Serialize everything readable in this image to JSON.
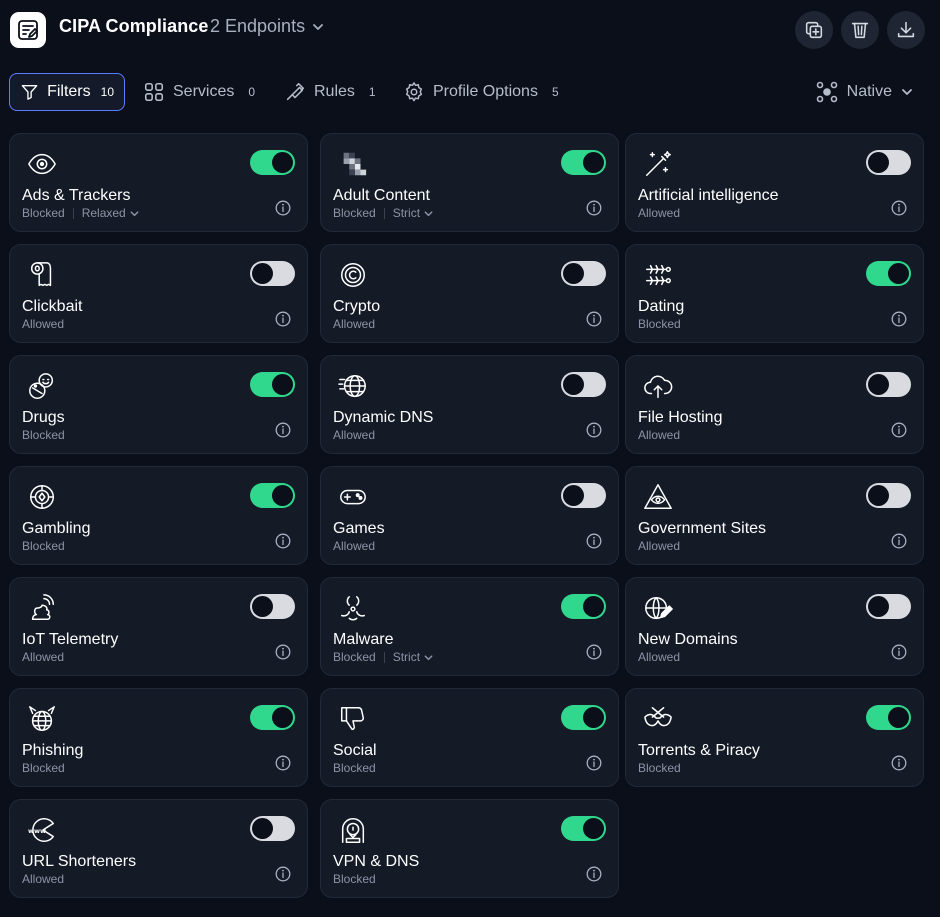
{
  "header": {
    "profile_name": "CIPA Compliance",
    "endpoints_label": "2 Endpoints"
  },
  "toolbar": {
    "tabs": [
      {
        "label": "Filters",
        "count": "10",
        "active": true,
        "icon": "filter-icon"
      },
      {
        "label": "Services",
        "count": "0",
        "active": false,
        "icon": "grid-icon"
      },
      {
        "label": "Rules",
        "count": "1",
        "active": false,
        "icon": "route-icon"
      },
      {
        "label": "Profile Options",
        "count": "5",
        "active": false,
        "icon": "gear-icon"
      }
    ],
    "mode_label": "Native"
  },
  "colors": {
    "background": "#0b0f1a",
    "card": "#141a26",
    "toggle_on": "#2fd88c",
    "toggle_off": "#d9dbe1",
    "active_tab_border": "#5c7cff"
  },
  "filters": [
    {
      "name": "Ads & Trackers",
      "status": "Blocked",
      "level": "Relaxed",
      "enabled": true,
      "icon": "eye-icon"
    },
    {
      "name": "Adult Content",
      "status": "Blocked",
      "level": "Strict",
      "enabled": true,
      "icon": "pixelated-icon"
    },
    {
      "name": "Artificial intelligence",
      "status": "Allowed",
      "level": "",
      "enabled": false,
      "icon": "magic-wand-icon"
    },
    {
      "name": "Clickbait",
      "status": "Allowed",
      "level": "",
      "enabled": false,
      "icon": "toilet-paper-icon"
    },
    {
      "name": "Crypto",
      "status": "Allowed",
      "level": "",
      "enabled": false,
      "icon": "crypto-coin-icon"
    },
    {
      "name": "Dating",
      "status": "Blocked",
      "level": "",
      "enabled": true,
      "icon": "fish-bones-icon"
    },
    {
      "name": "Drugs",
      "status": "Blocked",
      "level": "",
      "enabled": true,
      "icon": "pills-icon"
    },
    {
      "name": "Dynamic DNS",
      "status": "Allowed",
      "level": "",
      "enabled": false,
      "icon": "fast-globe-icon"
    },
    {
      "name": "File Hosting",
      "status": "Allowed",
      "level": "",
      "enabled": false,
      "icon": "cloud-upload-icon"
    },
    {
      "name": "Gambling",
      "status": "Blocked",
      "level": "",
      "enabled": true,
      "icon": "poker-chip-icon"
    },
    {
      "name": "Games",
      "status": "Allowed",
      "level": "",
      "enabled": false,
      "icon": "gamepad-icon"
    },
    {
      "name": "Government Sites",
      "status": "Allowed",
      "level": "",
      "enabled": false,
      "icon": "all-seeing-eye-icon"
    },
    {
      "name": "IoT Telemetry",
      "status": "Allowed",
      "level": "",
      "enabled": false,
      "icon": "poop-signal-icon"
    },
    {
      "name": "Malware",
      "status": "Blocked",
      "level": "Strict",
      "enabled": true,
      "icon": "biohazard-icon"
    },
    {
      "name": "New Domains",
      "status": "Allowed",
      "level": "",
      "enabled": false,
      "icon": "globe-pen-icon"
    },
    {
      "name": "Phishing",
      "status": "Blocked",
      "level": "",
      "enabled": true,
      "icon": "devil-globe-icon"
    },
    {
      "name": "Social",
      "status": "Blocked",
      "level": "",
      "enabled": true,
      "icon": "thumbs-down-icon"
    },
    {
      "name": "Torrents & Piracy",
      "status": "Blocked",
      "level": "",
      "enabled": true,
      "icon": "pirate-mask-icon"
    },
    {
      "name": "URL Shorteners",
      "status": "Allowed",
      "level": "",
      "enabled": false,
      "icon": "www-pacman-icon"
    },
    {
      "name": "VPN & DNS",
      "status": "Blocked",
      "level": "",
      "enabled": true,
      "icon": "vpn-hood-icon"
    }
  ]
}
